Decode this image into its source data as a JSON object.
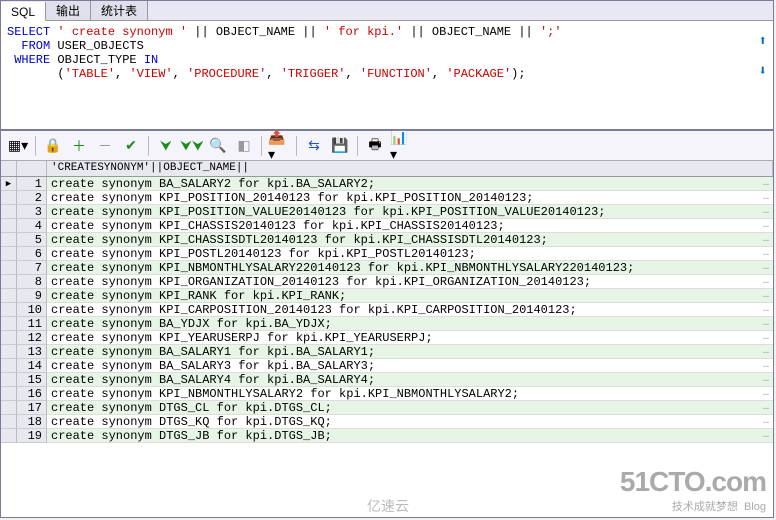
{
  "tabs": {
    "sql": "SQL",
    "output": "输出",
    "stats": "统计表"
  },
  "sql_tokens": {
    "select": "SELECT",
    "lit1": "' create synonym '",
    "concat": "||",
    "obj": "OBJECT_NAME",
    "lit2": "' for kpi.'",
    "lit3": "';'",
    "from": "  FROM",
    "user_objects": "USER_OBJECTS",
    "where": " WHERE",
    "object_type": "OBJECT_TYPE",
    "in": "IN",
    "list_open": "       (",
    "v_table": "'TABLE'",
    "v_view": "'VIEW'",
    "v_proc": "'PROCEDURE'",
    "v_trig": "'TRIGGER'",
    "v_func": "'FUNCTION'",
    "v_pkg": "'PACKAGE'",
    "list_close": ");"
  },
  "grid_header": "'CREATESYNONYM'||OBJECT_NAME||",
  "rows": [
    "create synonym BA_SALARY2 for kpi.BA_SALARY2;",
    "create synonym KPI_POSITION_20140123 for kpi.KPI_POSITION_20140123;",
    "create synonym KPI_POSITION_VALUE20140123 for kpi.KPI_POSITION_VALUE20140123;",
    "create synonym KPI_CHASSIS20140123 for kpi.KPI_CHASSIS20140123;",
    "create synonym KPI_CHASSISDTL20140123 for kpi.KPI_CHASSISDTL20140123;",
    "create synonym KPI_POSTL20140123 for kpi.KPI_POSTL20140123;",
    "create synonym KPI_NBMONTHLYSALARY220140123 for kpi.KPI_NBMONTHLYSALARY220140123;",
    "create synonym KPI_ORGANIZATION_20140123 for kpi.KPI_ORGANIZATION_20140123;",
    "create synonym KPI_RANK for kpi.KPI_RANK;",
    "create synonym KPI_CARPOSITION_20140123 for kpi.KPI_CARPOSITION_20140123;",
    "create synonym BA_YDJX for kpi.BA_YDJX;",
    "create synonym KPI_YEARUSERPJ for kpi.KPI_YEARUSERPJ;",
    "create synonym BA_SALARY1 for kpi.BA_SALARY1;",
    "create synonym BA_SALARY3 for kpi.BA_SALARY3;",
    "create synonym BA_SALARY4 for kpi.BA_SALARY4;",
    "create synonym KPI_NBMONTHLYSALARY2 for kpi.KPI_NBMONTHLYSALARY2;",
    "create synonym DTGS_CL for kpi.DTGS_CL;",
    "create synonym DTGS_KQ for kpi.DTGS_KQ;",
    "create synonym DTGS_JB for kpi.DTGS_JB;"
  ],
  "watermark": {
    "big": "51CTO.com",
    "sm": "技术成就梦想",
    "blog": "Blog",
    "center": "亿速云"
  }
}
